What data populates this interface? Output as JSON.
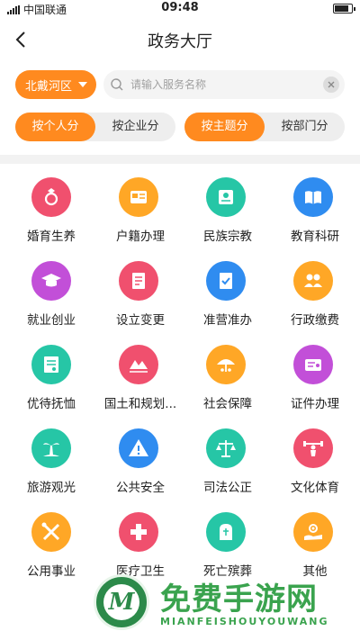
{
  "status": {
    "carrier": "中国联通",
    "time": "09:48",
    "battery_level": 0.9
  },
  "nav": {
    "title": "政务大厅"
  },
  "search": {
    "region": "北戴河区",
    "placeholder": "请输入服务名称",
    "value": ""
  },
  "segments_left": [
    {
      "label": "按个人分",
      "active": true
    },
    {
      "label": "按企业分",
      "active": false
    }
  ],
  "segments_right": [
    {
      "label": "按主题分",
      "active": true
    },
    {
      "label": "按部门分",
      "active": false
    }
  ],
  "services": [
    {
      "label": "婚育生养",
      "icon": "rings-icon",
      "color": "#f0506e"
    },
    {
      "label": "户籍办理",
      "icon": "id-card-icon",
      "color": "#ffa726"
    },
    {
      "label": "民族宗教",
      "icon": "certificate-icon",
      "color": "#26c6a6"
    },
    {
      "label": "教育科研",
      "icon": "book-icon",
      "color": "#2f8cf0"
    },
    {
      "label": "就业创业",
      "icon": "graduation-cap-icon",
      "color": "#c24fd8"
    },
    {
      "label": "设立变更",
      "icon": "document-icon",
      "color": "#f0506e"
    },
    {
      "label": "准营准办",
      "icon": "checked-document-icon",
      "color": "#2f8cf0"
    },
    {
      "label": "行政缴费",
      "icon": "people-icon",
      "color": "#ffa726"
    },
    {
      "label": "优待抚恤",
      "icon": "form-icon",
      "color": "#26c6a6"
    },
    {
      "label": "国土和规划...",
      "icon": "land-icon",
      "color": "#f0506e"
    },
    {
      "label": "社会保障",
      "icon": "umbrella-icon",
      "color": "#ffa726"
    },
    {
      "label": "证件办理",
      "icon": "license-icon",
      "color": "#c24fd8"
    },
    {
      "label": "旅游观光",
      "icon": "palm-tree-icon",
      "color": "#26c6a6"
    },
    {
      "label": "公共安全",
      "icon": "warning-icon",
      "color": "#2f8cf0"
    },
    {
      "label": "司法公正",
      "icon": "scales-icon",
      "color": "#26c6a6"
    },
    {
      "label": "文化体育",
      "icon": "weightlifting-icon",
      "color": "#f0506e"
    },
    {
      "label": "公用事业",
      "icon": "tools-icon",
      "color": "#ffa726"
    },
    {
      "label": "医疗卫生",
      "icon": "medical-cross-icon",
      "color": "#f0506e"
    },
    {
      "label": "死亡殡葬",
      "icon": "tombstone-icon",
      "color": "#26c6a6"
    },
    {
      "label": "其他",
      "icon": "hand-gear-icon",
      "color": "#ffa726"
    }
  ],
  "watermark": {
    "letter": "M",
    "title": "免费手游网",
    "subtitle": "MIANFEISHOUYOUWANG"
  }
}
